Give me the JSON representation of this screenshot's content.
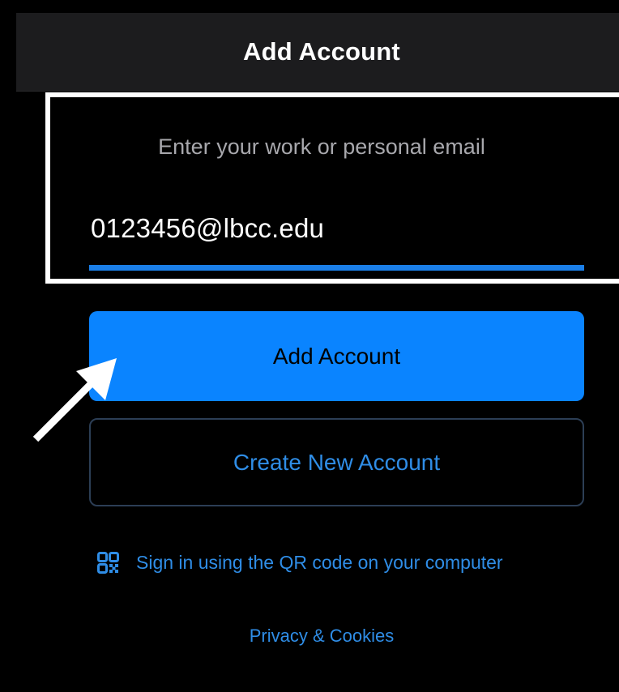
{
  "header": {
    "title": "Add Account"
  },
  "email_form": {
    "prompt": "Enter your work or personal email",
    "value": "0123456@lbcc.edu"
  },
  "buttons": {
    "add_account_label": "Add Account",
    "create_account_label": "Create New Account"
  },
  "links": {
    "qr_sign_in": "Sign in using the QR code on your computer",
    "qr_icon": "qr-code-icon",
    "privacy": "Privacy & Cookies"
  },
  "annotations": {
    "highlight_color": "#ffffff",
    "arrow_color": "#ffffff",
    "arrow_target": "Add Account button"
  },
  "colors": {
    "accent": "#0a84ff",
    "link": "#2f8de6",
    "background": "#000000",
    "title_bar": "#1c1c1e"
  }
}
